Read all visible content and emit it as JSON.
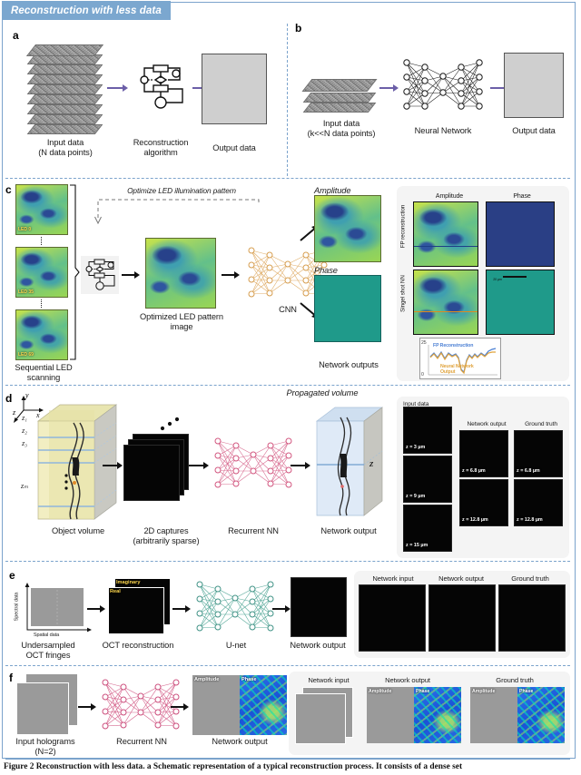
{
  "figure": {
    "banner_title": "Reconstruction with less data",
    "caption": "Figure 2 Reconstruction with less data. a Schematic representation of a typical reconstruction process. It consists of a dense set"
  },
  "panel_a": {
    "letter": "a",
    "input_label_line1": "Input data",
    "input_label_line2": "(N data points)",
    "process_label_line1": "Reconstruction",
    "process_label_line2": "algorithm",
    "output_label": "Output data"
  },
  "panel_b": {
    "letter": "b",
    "input_label_line1": "Input data",
    "input_label_line2": "(k<<N data points)",
    "network_label": "Neural Network",
    "output_label": "Output data"
  },
  "panel_c": {
    "letter": "c",
    "led_tiles": [
      "LED 0",
      "LED 35",
      "LED 69"
    ],
    "stack_label_line1": "Sequential LED",
    "stack_label_line2": "scanning",
    "optimize_label": "Optimize LED illumination pattern",
    "optimized_label_line1": "Optimized LED pattern",
    "optimized_label_line2": "image",
    "network_label": "CNN",
    "amplitude_label": "Amplitude",
    "phase_label": "Phase",
    "outputs_label": "Network outputs",
    "results": {
      "col_headers": [
        "Amplitude",
        "Phase"
      ],
      "row_headers": [
        "FP reconstruction",
        "Singel shot NN"
      ],
      "scalebar": "20 µm"
    },
    "inset_plot": {
      "y_max": "25",
      "y_min": "0",
      "series_1": "FP Reconstruction",
      "series_2_line1": "Neural Network",
      "series_2_line2": "Output"
    }
  },
  "panel_d": {
    "letter": "d",
    "axes": [
      "y",
      "x",
      "z"
    ],
    "z_labels": [
      "z₁",
      "z₂",
      "z₃",
      "zₘ"
    ],
    "volume_label": "Object volume",
    "captures_label_line1": "2D captures",
    "captures_label_line2": "(arbitrarily sparse)",
    "network_label": "Recurrent NN",
    "propagated_label": "Propagated volume",
    "z_axis_label": "z",
    "output_label": "Network output",
    "results": {
      "input_header": "Input data",
      "output_header": "Network output",
      "truth_header": "Ground truth",
      "input_z": [
        "z = 3 µm",
        "z = 9 µm",
        "z = 15 µm"
      ],
      "output_z": [
        "z = 6.8 µm",
        "z = 12.8 µm"
      ],
      "truth_z": [
        "z = 6.8 µm",
        "z = 12.8 µm"
      ]
    }
  },
  "panel_e": {
    "letter": "e",
    "y_axis": "Spectral data",
    "x_axis": "Spatial data",
    "input_label_line1": "Undersampled",
    "input_label_line2": "OCT fringes",
    "recon_label": "OCT reconstruction",
    "recon_tags": [
      "Imaginary",
      "Real"
    ],
    "network_label": "U-net",
    "output_label": "Network output",
    "results": {
      "headers": [
        "Network input",
        "Network output",
        "Ground truth"
      ]
    }
  },
  "panel_f": {
    "letter": "f",
    "input_label_line1": "Input holograms",
    "input_label_line2": "(N=2)",
    "network_label": "Recurrent NN",
    "output_label": "Network output",
    "output_tags": [
      "Amplitude",
      "Phase"
    ],
    "results": {
      "headers": [
        "Network input",
        "Network output",
        "Ground truth"
      ],
      "tags": [
        "Amplitude",
        "Phase"
      ]
    }
  },
  "colors": {
    "banner": "#7ba7cf",
    "frame_border": "#7ba3cc",
    "arrow_purple": "#6c5fa8",
    "nn_c": "#e0ae6a",
    "nn_d": "#d96f93",
    "nn_e": "#57a99a",
    "nn_f": "#d4608a"
  }
}
